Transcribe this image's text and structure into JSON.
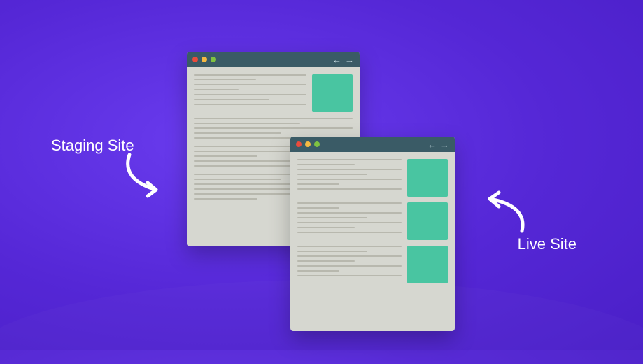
{
  "labels": {
    "staging": "Staging Site",
    "live": "Live Site"
  },
  "colors": {
    "background": "#5527d6",
    "window_body": "#d6d7d0",
    "titlebar": "#3a5b66",
    "accent": "#49c5a1",
    "dot_red": "#e94b3c",
    "dot_yellow": "#f4b942",
    "dot_green": "#7fc241"
  },
  "icons": {
    "back": "←",
    "forward": "→"
  }
}
